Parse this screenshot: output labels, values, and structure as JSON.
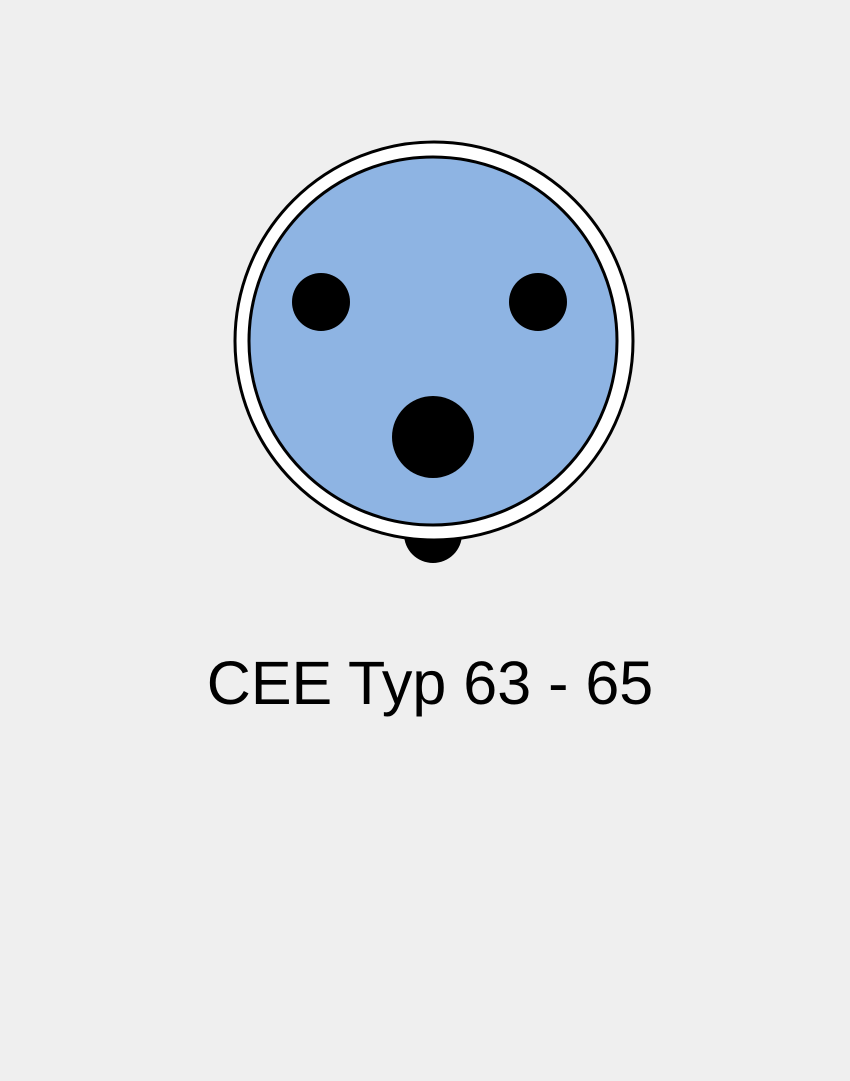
{
  "caption": "CEE Typ 63 - 65",
  "colors": {
    "background": "#efefef",
    "socket_face": "#8eb4e3",
    "outer_ring": "#ffffff",
    "outline": "#000000",
    "pins": "#000000"
  },
  "socket": {
    "pin_count": 3,
    "has_key_notch": true
  }
}
